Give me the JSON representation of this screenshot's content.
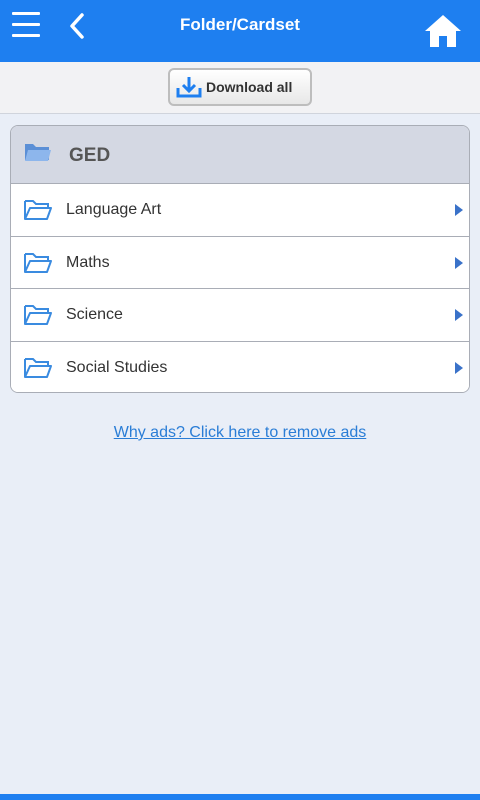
{
  "header": {
    "title": "Folder/Cardset",
    "menu_icon": "hamburger-icon",
    "back_icon": "chevron-left-icon",
    "home_icon": "home-icon"
  },
  "toolbar": {
    "download_label": "Download all",
    "download_icon": "download-icon"
  },
  "folder": {
    "title": "GED",
    "icon": "open-folder-icon",
    "items": [
      {
        "label": "Language Art"
      },
      {
        "label": "Maths"
      },
      {
        "label": "Science"
      },
      {
        "label": "Social Studies"
      }
    ]
  },
  "ads": {
    "link_text": "Why ads? Click here to remove ads"
  },
  "colors": {
    "primary": "#1e7ff0",
    "background": "#e9eef7",
    "folder_header": "#d4d8e3",
    "link": "#2a7dd6"
  }
}
